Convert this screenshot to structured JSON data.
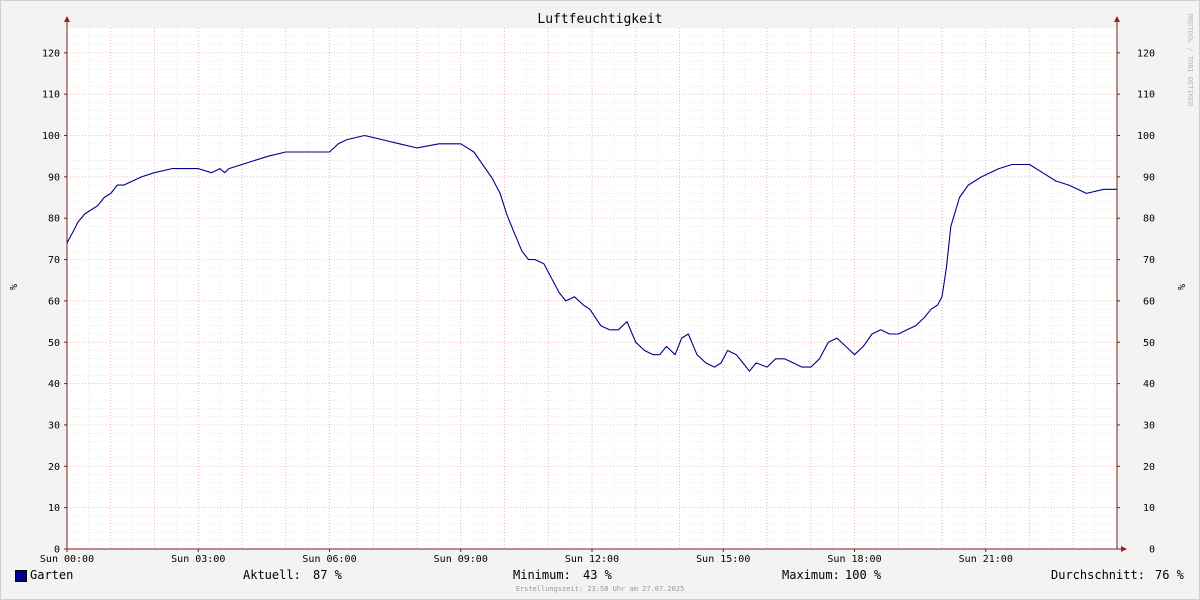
{
  "chart_data": {
    "type": "line",
    "title": "Luftfeuchtigkeit",
    "ylabel": "%",
    "ylabel_right": "%",
    "watermark": "RRDTOOL / TOBI OETIKER",
    "ylim": [
      0,
      126
    ],
    "yticks": [
      0,
      10,
      20,
      30,
      40,
      50,
      60,
      70,
      80,
      90,
      100,
      110,
      120
    ],
    "xlim": [
      0,
      24
    ],
    "xticks": [
      {
        "h": 0,
        "label": "Sun 00:00"
      },
      {
        "h": 3,
        "label": "Sun 03:00"
      },
      {
        "h": 6,
        "label": "Sun 06:00"
      },
      {
        "h": 9,
        "label": "Sun 09:00"
      },
      {
        "h": 12,
        "label": "Sun 12:00"
      },
      {
        "h": 15,
        "label": "Sun 15:00"
      },
      {
        "h": 18,
        "label": "Sun 18:00"
      },
      {
        "h": 21,
        "label": "Sun 21:00"
      }
    ],
    "grid": true,
    "series": [
      {
        "name": "Garten",
        "color": "#00008b",
        "x": [
          0,
          0.05,
          0.15,
          0.25,
          0.4,
          0.55,
          0.7,
          0.85,
          1.0,
          1.15,
          1.3,
          1.5,
          1.7,
          2.0,
          2.4,
          3.0,
          3.3,
          3.5,
          3.6,
          3.7,
          4.0,
          4.3,
          4.6,
          5.0,
          5.5,
          6.0,
          6.2,
          6.4,
          6.8,
          7.2,
          7.6,
          8.0,
          8.5,
          9.0,
          9.3,
          9.5,
          9.7,
          9.9,
          10.05,
          10.2,
          10.4,
          10.55,
          10.7,
          10.9,
          11.1,
          11.25,
          11.4,
          11.6,
          11.8,
          11.95,
          12.2,
          12.4,
          12.6,
          12.8,
          13.0,
          13.2,
          13.4,
          13.55,
          13.7,
          13.9,
          14.05,
          14.2,
          14.4,
          14.6,
          14.8,
          14.95,
          15.1,
          15.3,
          15.45,
          15.6,
          15.75,
          16.0,
          16.2,
          16.4,
          16.6,
          16.8,
          17.0,
          17.2,
          17.4,
          17.6,
          17.8,
          18.0,
          18.2,
          18.4,
          18.6,
          18.8,
          19.0,
          19.2,
          19.4,
          19.6,
          19.75,
          19.9,
          20.0,
          20.1,
          20.2,
          20.4,
          20.6,
          20.9,
          21.3,
          21.6,
          22.0,
          22.3,
          22.6,
          22.9,
          23.3,
          23.7,
          24.0
        ],
        "values": [
          74,
          75,
          77,
          79,
          81,
          82,
          83,
          85,
          86,
          88,
          88,
          89,
          90,
          91,
          92,
          92,
          91,
          92,
          91,
          92,
          93,
          94,
          95,
          96,
          96,
          96,
          98,
          99,
          100,
          99,
          98,
          97,
          98,
          98,
          96,
          93,
          90,
          86,
          81,
          77,
          72,
          70,
          70,
          69,
          65,
          62,
          60,
          61,
          59,
          58,
          54,
          53,
          53,
          55,
          50,
          48,
          47,
          47,
          49,
          47,
          51,
          52,
          47,
          45,
          44,
          45,
          48,
          47,
          45,
          43,
          45,
          44,
          46,
          46,
          45,
          44,
          44,
          46,
          50,
          51,
          49,
          47,
          49,
          52,
          53,
          52,
          52,
          53,
          54,
          56,
          58,
          59,
          61,
          68,
          78,
          85,
          88,
          90,
          92,
          93,
          93,
          91,
          89,
          88,
          86,
          87,
          87
        ]
      }
    ]
  },
  "legend": {
    "series_name": "Garten",
    "current_label": "Aktuell:",
    "current_value": "87 %",
    "min_label": "Minimum:",
    "min_value": "43 %",
    "max_label": "Maximum:",
    "max_value": "100 %",
    "avg_label": "Durchschnitt:",
    "avg_value": "76 %"
  },
  "footer": "Erstellungszeit: 23:58 Uhr am 27.07.2025"
}
